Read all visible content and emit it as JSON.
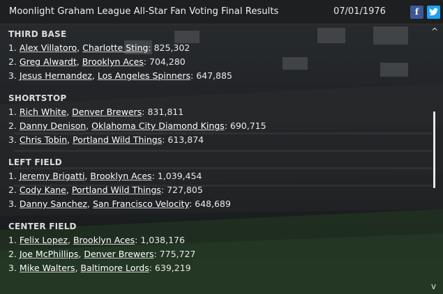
{
  "header": {
    "title": "Moonlight Graham League All-Star Fan Voting Final Results",
    "date": "07/01/1976",
    "facebook_glyph": "f"
  },
  "sections": [
    {
      "heading": "THIRD BASE",
      "entries": [
        {
          "rank": "1.",
          "player": "Alex Villatoro",
          "team": "Charlotte Sting",
          "votes": "825,302"
        },
        {
          "rank": "2.",
          "player": "Greg Alwardt",
          "team": "Brooklyn Aces",
          "votes": "704,280"
        },
        {
          "rank": "3.",
          "player": "Jesus Hernandez",
          "team": "Los Angeles Spinners",
          "votes": "647,885"
        }
      ]
    },
    {
      "heading": "SHORTSTOP",
      "entries": [
        {
          "rank": "1.",
          "player": "Rich White",
          "team": "Denver Brewers",
          "votes": "831,811"
        },
        {
          "rank": "2.",
          "player": "Danny Denison",
          "team": "Oklahoma City Diamond Kings",
          "votes": "690,715"
        },
        {
          "rank": "3.",
          "player": "Chris Tobin",
          "team": "Portland Wild Things",
          "votes": "613,874"
        }
      ]
    },
    {
      "heading": "LEFT FIELD",
      "entries": [
        {
          "rank": "1.",
          "player": "Jeremy Brigatti",
          "team": "Brooklyn Aces",
          "votes": "1,039,454"
        },
        {
          "rank": "2.",
          "player": "Cody Kane",
          "team": "Portland Wild Things",
          "votes": "727,805"
        },
        {
          "rank": "3.",
          "player": "Danny Sanchez",
          "team": "San Francisco Velocity",
          "votes": "648,689"
        }
      ]
    },
    {
      "heading": "CENTER FIELD",
      "entries": [
        {
          "rank": "1.",
          "player": "Felix Lopez",
          "team": "Brooklyn Aces",
          "votes": "1,038,176"
        },
        {
          "rank": "2.",
          "player": "Joe McPhillips",
          "team": "Denver Brewers",
          "votes": "775,727"
        },
        {
          "rank": "3.",
          "player": "Mike Walters",
          "team": "Baltimore Lords",
          "votes": "639,219"
        }
      ]
    }
  ],
  "icons": {
    "facebook": "facebook-icon",
    "twitter": "twitter-icon",
    "scroll_up": "chevron-up-icon",
    "scroll_down": "chevron-down-icon"
  },
  "scrollbar": {
    "up_glyph": "^",
    "down_glyph": "v"
  },
  "colors": {
    "facebook": "#3b5998",
    "twitter": "#1da1f2",
    "text": "#eaeaea"
  }
}
